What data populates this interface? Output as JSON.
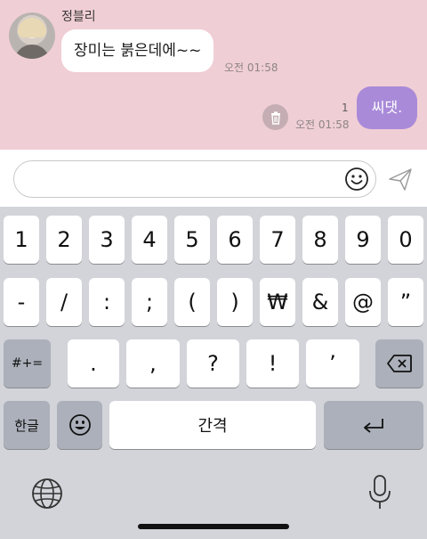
{
  "chat": {
    "sender_name": "정블리",
    "incoming_message": "장미는 붉은데에~~",
    "incoming_time": "오전 01:58",
    "outgoing_message": "씨댓.",
    "outgoing_unread_count": "1",
    "outgoing_time": "오전 01:58",
    "colors": {
      "background": "#f0ced5",
      "outgoing_bubble": "#a98ad9"
    }
  },
  "input": {
    "placeholder": "",
    "emoji_icon": "smiley-icon",
    "send_icon": "paper-plane-icon"
  },
  "keyboard": {
    "row1": [
      "1",
      "2",
      "3",
      "4",
      "5",
      "6",
      "7",
      "8",
      "9",
      "0"
    ],
    "row2": [
      "-",
      "/",
      ":",
      ";",
      "(",
      ")",
      "₩",
      "&",
      "@",
      "”"
    ],
    "row3": {
      "shift_label": "#+=",
      "keys": [
        ".",
        ",",
        "?",
        "!",
        "’"
      ],
      "delete_icon": "backspace-icon"
    },
    "row4": {
      "lang_label": "한글",
      "emoji_icon": "emoji-icon",
      "space_label": "간격",
      "return_icon": "return-icon"
    },
    "bottom": {
      "globe_icon": "globe-icon",
      "mic_icon": "microphone-icon"
    }
  }
}
